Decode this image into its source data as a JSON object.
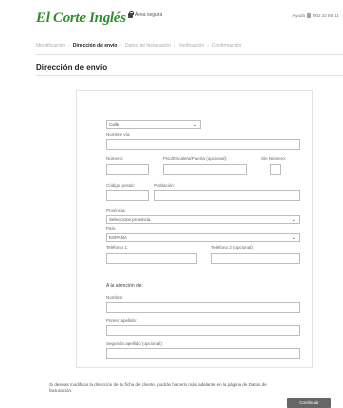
{
  "header": {
    "logo": "El Corte Inglés",
    "secure_label": "Área segura",
    "help_label": "Ayuda",
    "phone": "902 22 88 11"
  },
  "breadcrumb": {
    "steps": [
      "Identificación",
      "Dirección de envío",
      "Datos de facturación",
      "Verificación",
      "Confirmación"
    ],
    "active_index": 1
  },
  "page": {
    "title": "Dirección de envío"
  },
  "form": {
    "street_type": {
      "value": "Calle"
    },
    "street_name": {
      "label": "Nombre vía:"
    },
    "number": {
      "label": "Número:"
    },
    "floor": {
      "label": "Piso/Escalera/Puerta (opcional):"
    },
    "no_number": {
      "label": "Sin Número:"
    },
    "postal_code": {
      "label": "Código postal:"
    },
    "city": {
      "label": "Población:"
    },
    "province": {
      "label": "Provincia:",
      "value": "Seleccione provincia"
    },
    "country": {
      "label": "País:",
      "value": "ESPAÑA"
    },
    "phone1": {
      "label": "Teléfono 1:"
    },
    "phone2": {
      "label": "Teléfono 2 (opcional):"
    },
    "attention_heading": "A la atención de:",
    "name": {
      "label": "Nombre:"
    },
    "surname1": {
      "label": "Primer apellido:"
    },
    "surname2": {
      "label": "Segundo apellido (opcional):"
    }
  },
  "footer": {
    "note": "Si deseas modificar la dirección de tu ficha de cliente, podrás hacerlo más adelante en la página de Datos de facturación.",
    "continue_label": "Continuar"
  }
}
